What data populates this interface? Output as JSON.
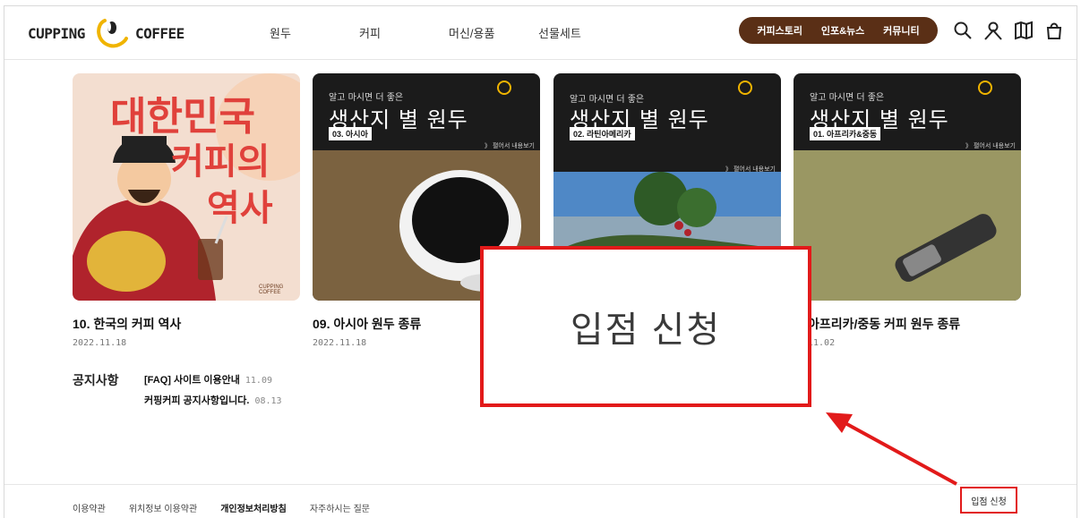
{
  "logo": {
    "left_text": "CUPPING",
    "right_text": "COFFEE"
  },
  "nav": [
    "원두",
    "커피",
    "머신/용품",
    "선물세트"
  ],
  "pill": [
    "커피스토리",
    "인포&뉴스",
    "커뮤니티"
  ],
  "icons": [
    "search-icon",
    "user-icon",
    "map-icon",
    "bag-icon"
  ],
  "cards": [
    {
      "title": "10. 한국의 커피 역사",
      "date": "2022.11.18",
      "art": {
        "line1": "대한민국",
        "line2": "커피의",
        "line3": "역사",
        "brand": "CUPPING COFFEE"
      }
    },
    {
      "title": "09. 아시아 원두 종류",
      "date": "2022.11.18",
      "art": {
        "small": "알고 마시면 더 좋은",
        "big": "생산지 별 원두",
        "tag": "03. 아시아",
        "more": "》 펼어서 내용보기"
      }
    },
    {
      "title": "",
      "date": "",
      "art": {
        "small": "알고 마시면 더 좋은",
        "big": "생산지 별 원두",
        "tag": "02. 라틴아메리카",
        "more": "》 펼어서 내용보기"
      }
    },
    {
      "title": "아프리카/중동 커피 원두 종류",
      "date": "11.02",
      "art": {
        "small": "알고 마시면 더 좋은",
        "big": "생산지 별 원두",
        "tag": "01. 아프리카&중동",
        "more": "》 펼어서 내용보기"
      }
    }
  ],
  "notices": {
    "heading": "공지사항",
    "items": [
      {
        "text": "[FAQ] 사이트 이용안내",
        "date": "11.09"
      },
      {
        "text": "커핑커피 공지사항입니다.",
        "date": "08.13"
      }
    ]
  },
  "footer": {
    "links": [
      "이용약관",
      "위치정보 이용약관",
      "개인정보처리방침",
      "자주하시는 질문"
    ],
    "apply": "입점 신청"
  },
  "callout": {
    "text": "입점 신청"
  },
  "colors": {
    "brand_brown": "#5a2f16",
    "highlight_red": "#e21a1a",
    "logo_gold": "#f0b400"
  }
}
